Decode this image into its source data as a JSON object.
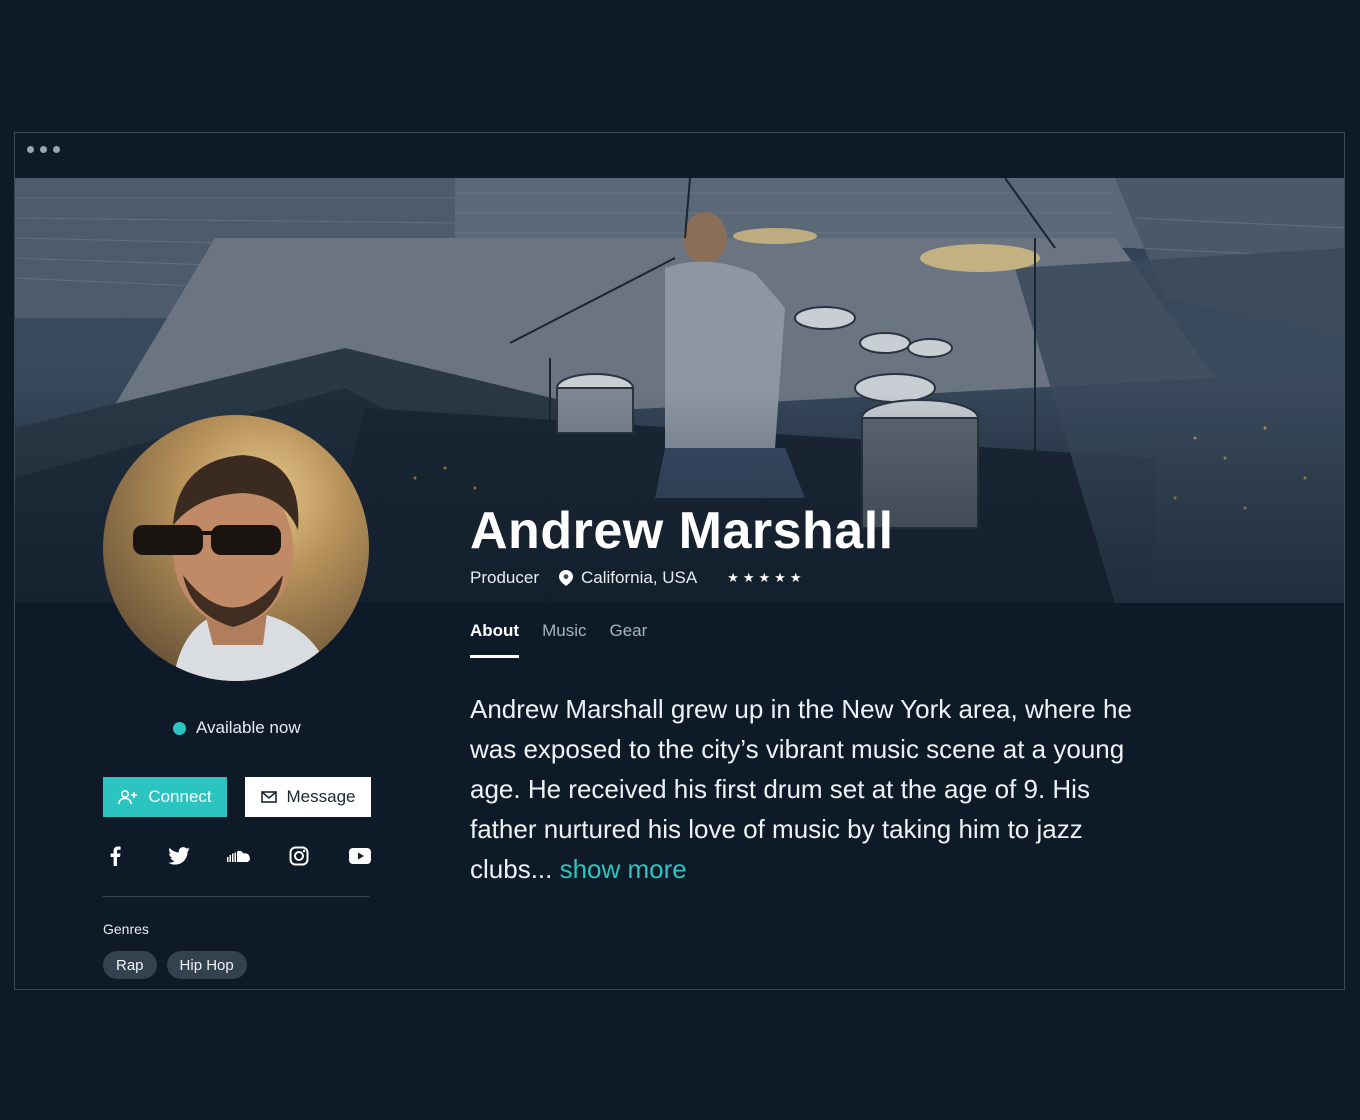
{
  "profile": {
    "name": "Andrew Marshall",
    "role": "Producer",
    "location": "California, USA",
    "rating": 5,
    "availability": "Available now"
  },
  "actions": {
    "connect_label": "Connect",
    "message_label": "Message"
  },
  "socials": [
    "facebook-icon",
    "twitter-icon",
    "soundcloud-icon",
    "instagram-icon",
    "youtube-icon"
  ],
  "genres": {
    "label": "Genres",
    "items": [
      "Rap",
      "Hip Hop"
    ]
  },
  "tabs": [
    {
      "label": "About",
      "active": true
    },
    {
      "label": "Music",
      "active": false
    },
    {
      "label": "Gear",
      "active": false
    }
  ],
  "bio": {
    "text": "Andrew Marshall grew up in the New York area, where he was exposed to the city’s vibrant music scene at a young age. He received his first drum set at the age of 9. His father nurtured his love of music by taking him to jazz clubs... ",
    "more_label": "show more"
  },
  "colors": {
    "background": "#0e1a28",
    "accent": "#2bc4c0",
    "chip": "#34414f"
  }
}
